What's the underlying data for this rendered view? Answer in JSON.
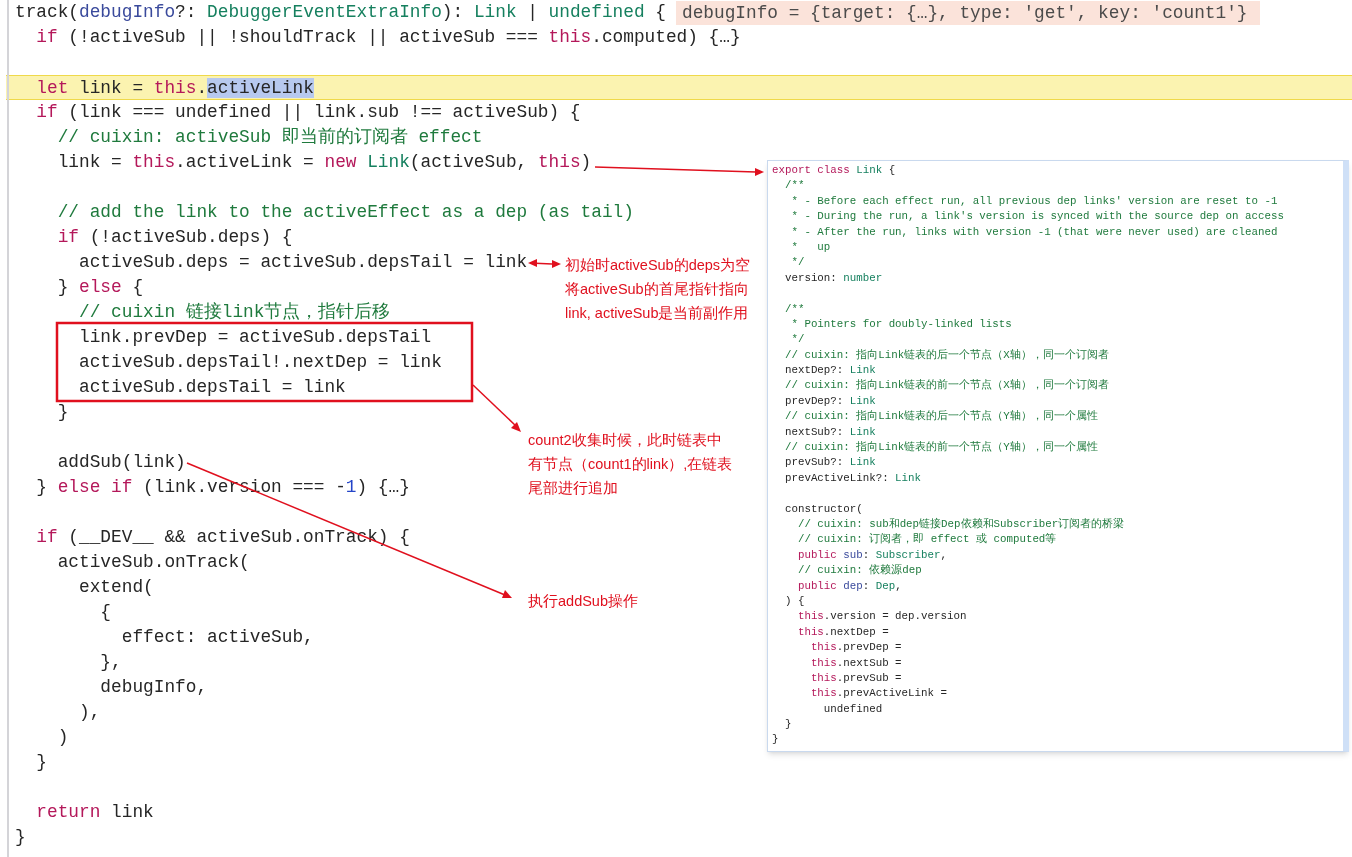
{
  "editor": {
    "lines": [
      {
        "current": false,
        "tokens": [
          {
            "kind": "plain",
            "text": "track("
          },
          {
            "kind": "param",
            "text": "debugInfo"
          },
          {
            "kind": "plain",
            "text": "?: "
          },
          {
            "kind": "type",
            "text": "DebuggerEventExtraInfo"
          },
          {
            "kind": "plain",
            "text": "): "
          },
          {
            "kind": "type",
            "text": "Link"
          },
          {
            "kind": "plain",
            "text": " | "
          },
          {
            "kind": "type",
            "text": "undefined"
          },
          {
            "kind": "plain",
            "text": " {"
          }
        ],
        "inline_value": "debugInfo = {target: {…}, type: 'get', key: 'count1'}"
      },
      {
        "current": false,
        "tokens": [
          {
            "kind": "keyword",
            "text": "  if"
          },
          {
            "kind": "plain",
            "text": " (!activeSub || !shouldTrack || activeSub === "
          },
          {
            "kind": "keyword",
            "text": "this"
          },
          {
            "kind": "plain",
            "text": ".computed) {…}"
          }
        ]
      },
      {
        "current": false
      },
      {
        "current": true,
        "tokens": [
          {
            "kind": "keyword",
            "text": "  let"
          },
          {
            "kind": "plain",
            "text": " link = "
          },
          {
            "kind": "keyword",
            "text": "this"
          },
          {
            "kind": "plain",
            "text": "."
          },
          {
            "kind": "selection",
            "text": "activeLink"
          }
        ]
      },
      {
        "current": false,
        "tokens": [
          {
            "kind": "keyword",
            "text": "  if"
          },
          {
            "kind": "plain",
            "text": " (link === undefined || link.sub !== activeSub) {"
          }
        ]
      },
      {
        "current": false,
        "tokens": [
          {
            "kind": "comment",
            "text": "    // cuixin: activeSub 即当前的订阅者 effect"
          }
        ]
      },
      {
        "current": false,
        "tokens": [
          {
            "kind": "plain",
            "text": "    link = "
          },
          {
            "kind": "keyword",
            "text": "this"
          },
          {
            "kind": "plain",
            "text": ".activeLink = "
          },
          {
            "kind": "keyword",
            "text": "new "
          },
          {
            "kind": "type",
            "text": "Link"
          },
          {
            "kind": "plain",
            "text": "(activeSub, "
          },
          {
            "kind": "keyword",
            "text": "this"
          },
          {
            "kind": "plain",
            "text": ")"
          }
        ]
      },
      {
        "current": false
      },
      {
        "current": false,
        "tokens": [
          {
            "kind": "comment",
            "text": "    // add the link to the activeEffect as a dep (as tail)"
          }
        ]
      },
      {
        "current": false,
        "tokens": [
          {
            "kind": "keyword",
            "text": "    if"
          },
          {
            "kind": "plain",
            "text": " (!activeSub.deps) {"
          }
        ]
      },
      {
        "current": false,
        "tokens": [
          {
            "kind": "plain",
            "text": "      activeSub.deps = activeSub.depsTail = link"
          }
        ]
      },
      {
        "current": false,
        "tokens": [
          {
            "kind": "plain",
            "text": "    } "
          },
          {
            "kind": "keyword",
            "text": "else"
          },
          {
            "kind": "plain",
            "text": " {"
          }
        ]
      },
      {
        "current": false,
        "tokens": [
          {
            "kind": "comment",
            "text": "      // cuixin 链接link节点，指针后移"
          }
        ]
      },
      {
        "current": false,
        "tokens": [
          {
            "kind": "plain",
            "text": "      link.prevDep = activeSub.depsTail"
          }
        ]
      },
      {
        "current": false,
        "tokens": [
          {
            "kind": "plain",
            "text": "      activeSub.depsTail!.nextDep = link"
          }
        ]
      },
      {
        "current": false,
        "tokens": [
          {
            "kind": "plain",
            "text": "      activeSub.depsTail = link"
          }
        ]
      },
      {
        "current": false,
        "tokens": [
          {
            "kind": "plain",
            "text": "    }"
          }
        ]
      },
      {
        "current": false
      },
      {
        "current": false,
        "tokens": [
          {
            "kind": "plain",
            "text": "    addSub(link)"
          }
        ]
      },
      {
        "current": false,
        "tokens": [
          {
            "kind": "plain",
            "text": "  } "
          },
          {
            "kind": "keyword",
            "text": "else if"
          },
          {
            "kind": "plain",
            "text": " (link.version === -"
          },
          {
            "kind": "number",
            "text": "1"
          },
          {
            "kind": "plain",
            "text": ") {…}"
          }
        ]
      },
      {
        "current": false
      },
      {
        "current": false,
        "tokens": [
          {
            "kind": "keyword",
            "text": "  if"
          },
          {
            "kind": "plain",
            "text": " (__DEV__ && activeSub.onTrack) {"
          }
        ]
      },
      {
        "current": false,
        "tokens": [
          {
            "kind": "plain",
            "text": "    activeSub.onTrack("
          }
        ]
      },
      {
        "current": false,
        "tokens": [
          {
            "kind": "plain",
            "text": "      extend("
          }
        ]
      },
      {
        "current": false,
        "tokens": [
          {
            "kind": "plain",
            "text": "        {"
          }
        ]
      },
      {
        "current": false,
        "tokens": [
          {
            "kind": "plain",
            "text": "          effect: activeSub,"
          }
        ]
      },
      {
        "current": false,
        "tokens": [
          {
            "kind": "plain",
            "text": "        },"
          }
        ]
      },
      {
        "current": false,
        "tokens": [
          {
            "kind": "plain",
            "text": "        debugInfo,"
          }
        ]
      },
      {
        "current": false,
        "tokens": [
          {
            "kind": "plain",
            "text": "      ),"
          }
        ]
      },
      {
        "current": false,
        "tokens": [
          {
            "kind": "plain",
            "text": "    )"
          }
        ]
      },
      {
        "current": false,
        "tokens": [
          {
            "kind": "plain",
            "text": "  }"
          }
        ]
      },
      {
        "current": false
      },
      {
        "current": false,
        "tokens": [
          {
            "kind": "keyword",
            "text": "  return"
          },
          {
            "kind": "plain",
            "text": " link"
          }
        ]
      },
      {
        "current": false,
        "tokens": [
          {
            "kind": "plain",
            "text": "}"
          }
        ]
      }
    ]
  },
  "popup": {
    "lines": [
      {
        "tokens": [
          {
            "kind": "keyword",
            "text": "export class "
          },
          {
            "kind": "type",
            "text": "Link"
          },
          {
            "kind": "plain",
            "text": " {"
          }
        ]
      },
      {
        "tokens": [
          {
            "kind": "comment",
            "text": "  /**"
          }
        ]
      },
      {
        "tokens": [
          {
            "kind": "comment",
            "text": "   * - Before each effect run, all previous dep links' version are reset to -1"
          }
        ]
      },
      {
        "tokens": [
          {
            "kind": "comment",
            "text": "   * - During the run, a link's version is synced with the source dep on access"
          }
        ]
      },
      {
        "tokens": [
          {
            "kind": "comment",
            "text": "   * - After the run, links with version -1 (that were never used) are cleaned"
          }
        ]
      },
      {
        "tokens": [
          {
            "kind": "comment",
            "text": "   *   up"
          }
        ]
      },
      {
        "tokens": [
          {
            "kind": "comment",
            "text": "   */"
          }
        ]
      },
      {
        "tokens": [
          {
            "kind": "plain",
            "text": "  version: "
          },
          {
            "kind": "type",
            "text": "number"
          }
        ]
      },
      {
        "gap_before": true,
        "tokens": [
          {
            "kind": "comment",
            "text": "  /**"
          }
        ]
      },
      {
        "tokens": [
          {
            "kind": "comment",
            "text": "   * Pointers for doubly-linked lists"
          }
        ]
      },
      {
        "tokens": [
          {
            "kind": "comment",
            "text": "   */"
          }
        ]
      },
      {
        "tokens": [
          {
            "kind": "comment",
            "text": "  // cuixin: 指向Link链表的后一个节点（X轴），同一个订阅者"
          }
        ]
      },
      {
        "tokens": [
          {
            "kind": "plain",
            "text": "  nextDep?: "
          },
          {
            "kind": "type",
            "text": "Link"
          }
        ]
      },
      {
        "tokens": [
          {
            "kind": "comment",
            "text": "  // cuixin: 指向Link链表的前一个节点（X轴），同一个订阅者"
          }
        ]
      },
      {
        "tokens": [
          {
            "kind": "plain",
            "text": "  prevDep?: "
          },
          {
            "kind": "type",
            "text": "Link"
          }
        ]
      },
      {
        "tokens": [
          {
            "kind": "comment",
            "text": "  // cuixin: 指向Link链表的后一个节点（Y轴），同一个属性"
          }
        ]
      },
      {
        "tokens": [
          {
            "kind": "plain",
            "text": "  nextSub?: "
          },
          {
            "kind": "type",
            "text": "Link"
          }
        ]
      },
      {
        "tokens": [
          {
            "kind": "comment",
            "text": "  // cuixin: 指向Link链表的前一个节点（Y轴），同一个属性"
          }
        ]
      },
      {
        "tokens": [
          {
            "kind": "plain",
            "text": "  prevSub?: "
          },
          {
            "kind": "type",
            "text": "Link"
          }
        ]
      },
      {
        "tokens": [
          {
            "kind": "plain",
            "text": "  prevActiveLink?: "
          },
          {
            "kind": "type",
            "text": "Link"
          }
        ]
      },
      {
        "gap_before": true,
        "tokens": [
          {
            "kind": "plain",
            "text": "  constructor("
          }
        ]
      },
      {
        "tokens": [
          {
            "kind": "comment",
            "text": "    // cuixin: sub和dep链接Dep依赖和Subscriber订阅者的桥梁"
          }
        ]
      },
      {
        "tokens": [
          {
            "kind": "comment",
            "text": "    // cuixin: 订阅者，即 effect 或 computed等"
          }
        ]
      },
      {
        "tokens": [
          {
            "kind": "keyword",
            "text": "    public "
          },
          {
            "kind": "param",
            "text": "sub"
          },
          {
            "kind": "plain",
            "text": ": "
          },
          {
            "kind": "type",
            "text": "Subscriber"
          },
          {
            "kind": "plain",
            "text": ","
          }
        ]
      },
      {
        "tokens": [
          {
            "kind": "comment",
            "text": "    // cuixin: 依赖源dep"
          }
        ]
      },
      {
        "tokens": [
          {
            "kind": "keyword",
            "text": "    public "
          },
          {
            "kind": "param",
            "text": "dep"
          },
          {
            "kind": "plain",
            "text": ": "
          },
          {
            "kind": "type",
            "text": "Dep"
          },
          {
            "kind": "plain",
            "text": ","
          }
        ]
      },
      {
        "tokens": [
          {
            "kind": "plain",
            "text": "  ) {"
          }
        ]
      },
      {
        "tokens": [
          {
            "kind": "keyword",
            "text": "    this"
          },
          {
            "kind": "plain",
            "text": ".version = dep.version"
          }
        ]
      },
      {
        "tokens": [
          {
            "kind": "keyword",
            "text": "    this"
          },
          {
            "kind": "plain",
            "text": ".nextDep ="
          }
        ]
      },
      {
        "tokens": [
          {
            "kind": "keyword",
            "text": "      this"
          },
          {
            "kind": "plain",
            "text": ".prevDep ="
          }
        ]
      },
      {
        "tokens": [
          {
            "kind": "keyword",
            "text": "      this"
          },
          {
            "kind": "plain",
            "text": ".nextSub ="
          }
        ]
      },
      {
        "tokens": [
          {
            "kind": "keyword",
            "text": "      this"
          },
          {
            "kind": "plain",
            "text": ".prevSub ="
          }
        ]
      },
      {
        "tokens": [
          {
            "kind": "keyword",
            "text": "      this"
          },
          {
            "kind": "plain",
            "text": ".prevActiveLink ="
          }
        ]
      },
      {
        "tokens": [
          {
            "kind": "plain",
            "text": "        undefined"
          }
        ]
      },
      {
        "tokens": [
          {
            "kind": "plain",
            "text": "  }"
          }
        ]
      },
      {
        "tokens": [
          {
            "kind": "plain",
            "text": "}"
          }
        ]
      }
    ]
  },
  "annotations": [
    {
      "lines": [
        "初始时activeSub的deps为空",
        "将activeSub的首尾指针指向",
        "link, activeSub是当前副作用"
      ]
    },
    {
      "lines": [
        "count2收集时候，此时链表中",
        "有节点（count1的link）,在链表",
        "尾部进行追加"
      ]
    },
    {
      "lines": [
        "执行addSub操作"
      ]
    }
  ]
}
